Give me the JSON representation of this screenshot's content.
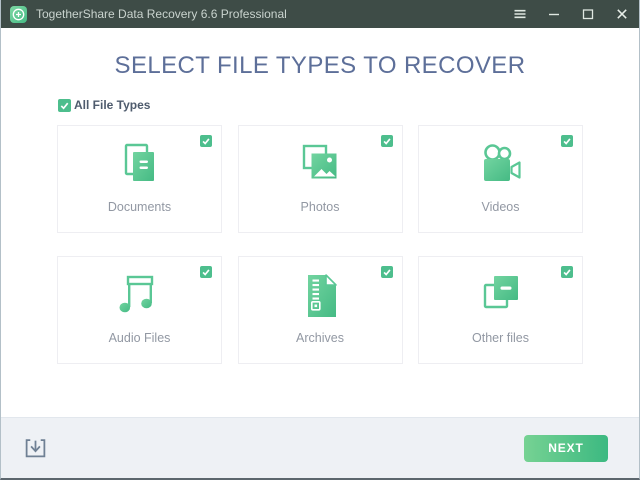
{
  "window": {
    "title": "TogetherShare Data Recovery 6.6 Professional",
    "app_icon": "plus-circle-app-icon",
    "controls": {
      "menu_icon": "hamburger-menu-icon",
      "minimize_icon": "minimize-icon",
      "maximize_icon": "maximize-icon",
      "close_icon": "close-icon"
    }
  },
  "main": {
    "heading": "SELECT FILE TYPES TO RECOVER",
    "select_all": {
      "label": "All File Types",
      "checked": true
    }
  },
  "file_type_cards": [
    {
      "label": "Documents",
      "icon": "documents-icon",
      "checked": true
    },
    {
      "label": "Photos",
      "icon": "photos-icon",
      "checked": true
    },
    {
      "label": "Videos",
      "icon": "videos-icon",
      "checked": true
    },
    {
      "label": "Audio Files",
      "icon": "audio-files-icon",
      "checked": true
    },
    {
      "label": "Archives",
      "icon": "archives-icon",
      "checked": true
    },
    {
      "label": "Other files",
      "icon": "other-files-icon",
      "checked": true
    }
  ],
  "footer": {
    "import_icon": "import-download-icon",
    "next_label": "NEXT"
  },
  "colors": {
    "titlebar_bg": "#3e4c47",
    "accent_green": "#4dbe8d",
    "icon_green_light": "#72d4a0",
    "icon_green_dark": "#45ba84",
    "heading_text": "#5d6f99",
    "select_all_text": "#4e5b6d",
    "card_label_text": "#9298a3",
    "footer_bg": "#eef1f5",
    "next_gradient_start": "#76d293",
    "next_gradient_end": "#3cb981"
  }
}
